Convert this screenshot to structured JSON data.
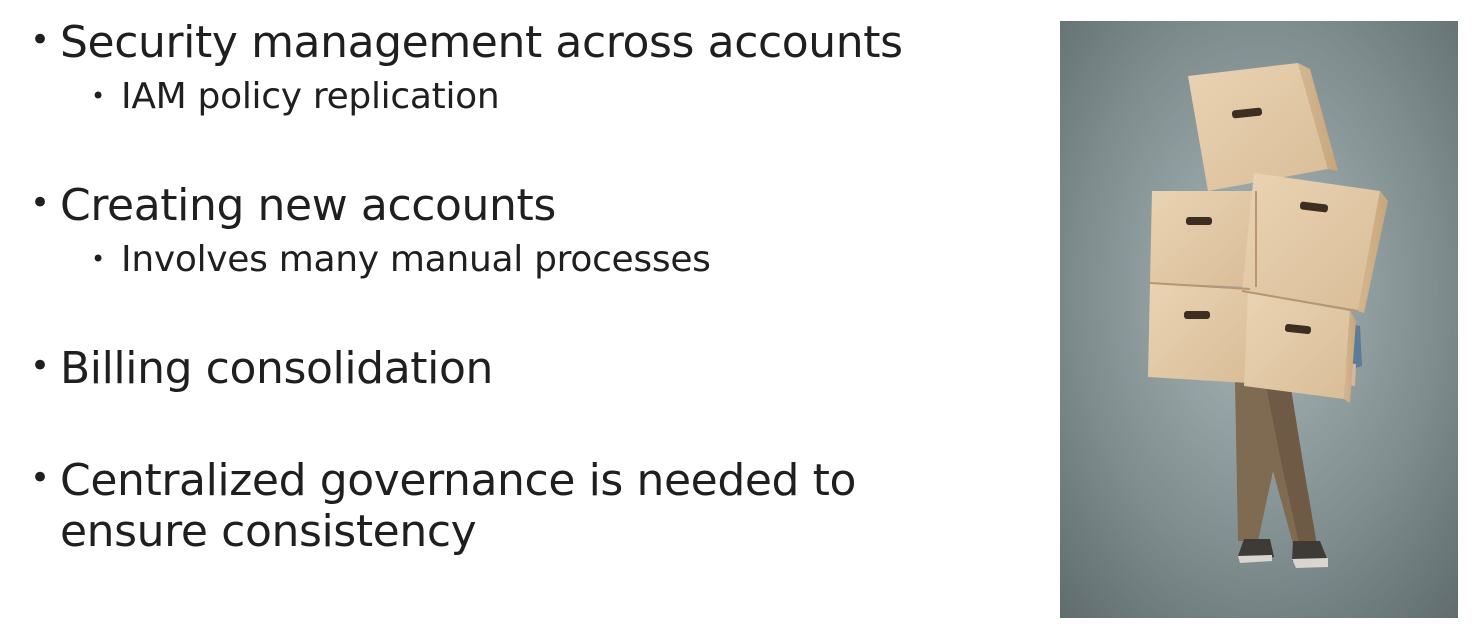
{
  "bullets": [
    {
      "text": "Security management across accounts",
      "subitems": [
        "IAM policy replication"
      ]
    },
    {
      "text": "Creating new accounts",
      "subitems": [
        "Involves many manual processes"
      ]
    },
    {
      "text": "Billing consolidation",
      "subitems": []
    },
    {
      "text": "Centralized governance is needed to ensure consistency",
      "subitems": []
    }
  ],
  "image": {
    "name": "person-carrying-boxes",
    "colors": {
      "background": "#7f8d8f",
      "boxes": "#e1c7a4",
      "boxes_shadow": "#cfae88",
      "pants": "#7f6a52",
      "shoes": "#3e3a36",
      "sleeve": "#5a7c99"
    }
  }
}
